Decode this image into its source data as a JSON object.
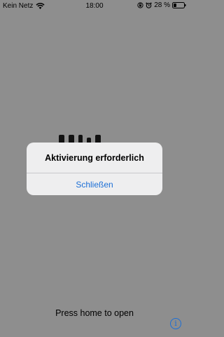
{
  "status_bar": {
    "carrier": "Kein Netz",
    "time": "18:00",
    "battery_percent": "28 %",
    "battery_level": 0.28,
    "icons": [
      "wifi-icon",
      "orientation-lock-icon",
      "alarm-icon",
      "battery-icon"
    ]
  },
  "background": {
    "footer_text": "Press home to open",
    "info_icon": "info-icon"
  },
  "alert": {
    "title": "Aktivierung erforderlich",
    "button_label": "Schließen"
  },
  "colors": {
    "accent": "#1c6fd6",
    "backdrop": "#8e8e8e",
    "alert_bg": "#eeeeef"
  }
}
